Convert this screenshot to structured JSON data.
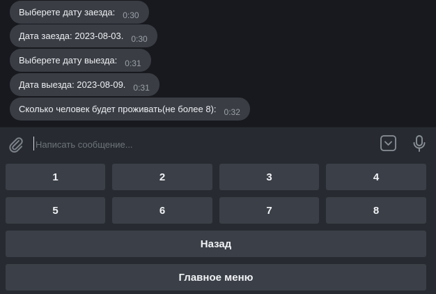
{
  "chat": {
    "messages": [
      {
        "text": "Выберете дату заезда:",
        "time": "0:30"
      },
      {
        "text": "Дата заезда: 2023-08-03.",
        "time": "0:30"
      },
      {
        "text": "Выберете дату выезда:",
        "time": "0:31"
      },
      {
        "text": "Дата выезда: 2023-08-09.",
        "time": "0:31"
      },
      {
        "text": "Сколько человек будет проживать(не более 8):",
        "time": "0:32"
      }
    ]
  },
  "composer": {
    "placeholder": "Написать сообщение..."
  },
  "keyboard": {
    "row1": [
      "1",
      "2",
      "3",
      "4"
    ],
    "row2": [
      "5",
      "6",
      "7",
      "8"
    ],
    "back": "Назад",
    "main_menu": "Главное меню"
  },
  "icons": {
    "attach": "paperclip-icon",
    "keyboard_toggle": "keyboard-toggle-icon",
    "mic": "microphone-icon"
  },
  "colors": {
    "chat_bg": "#17191e",
    "bubble_bg": "#3a3d44",
    "panel_bg": "#272b31",
    "key_bg": "#3b3f47"
  }
}
